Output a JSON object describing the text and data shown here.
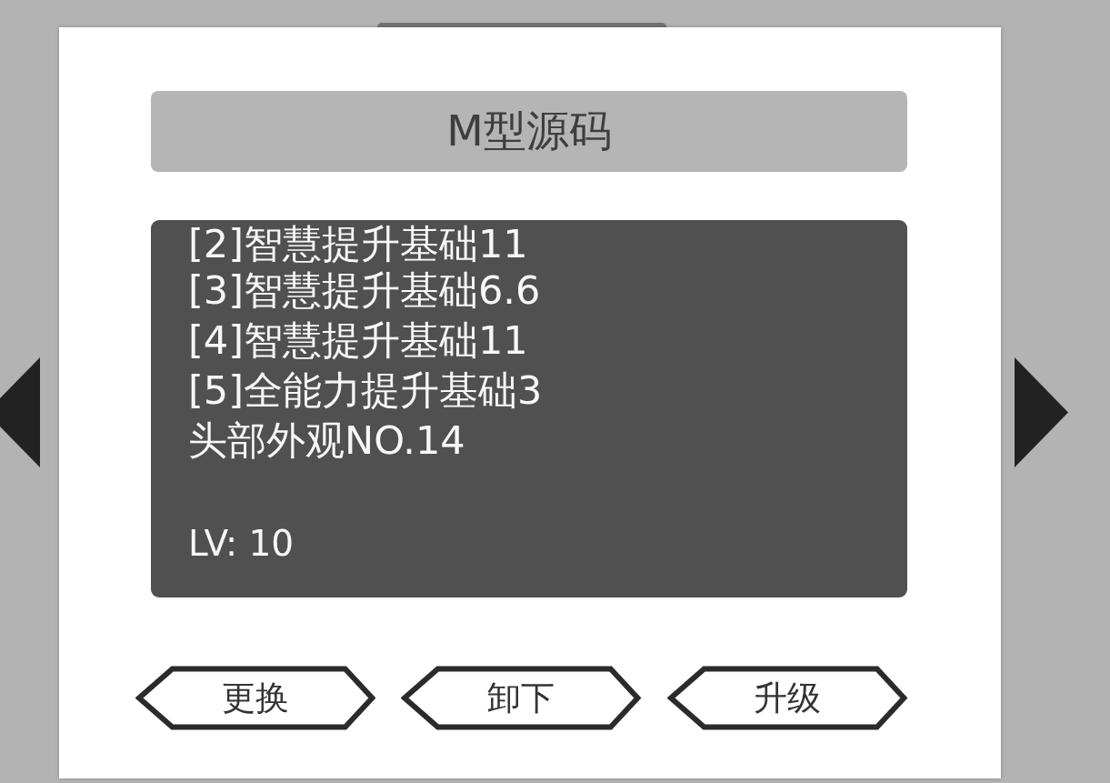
{
  "title": "M型源码",
  "details": {
    "lines": [
      "[2]智慧提升基础11",
      "[3]智慧提升基础6.6",
      "[4]智慧提升基础11",
      "[5]全能力提升基础3",
      "头部外观NO.14"
    ],
    "lv_label": "LV: 10"
  },
  "buttons": [
    "更换",
    "卸下",
    "升级"
  ]
}
